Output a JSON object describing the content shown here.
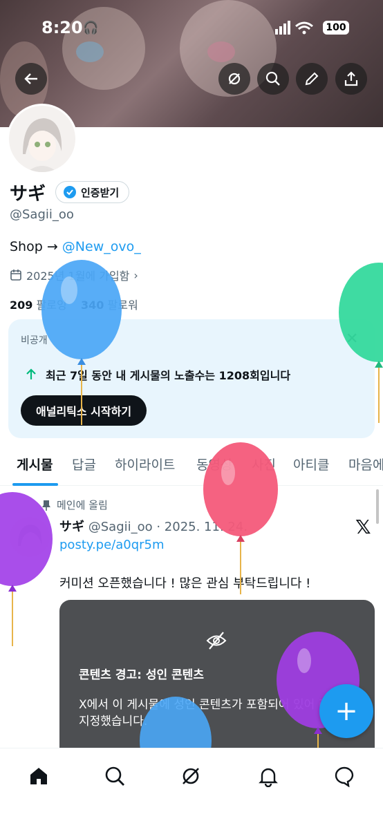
{
  "status_bar": {
    "time": "8:20",
    "battery": "100"
  },
  "profile": {
    "name": "サギ",
    "verify_label": "인증받기",
    "handle": "@Sagii_oo",
    "bio_prefix": "Shop → ",
    "bio_link": "@New_ovo_",
    "joined": "2025년 1월에 가입함",
    "following_count": "209",
    "following_label": "팔로잉",
    "followers_count": "340",
    "followers_label": "팔로워"
  },
  "analytics_card": {
    "private_label": "비공개",
    "stat_text": "최근 7일 동안 내 게시물의 노출수는 1208회입니다",
    "cta_label": "애널리틱스 시작하기"
  },
  "tabs": [
    "게시물",
    "답글",
    "하이라이트",
    "동영상",
    "사진",
    "아티클",
    "마음에"
  ],
  "post": {
    "pinned_label": "메인에 올림",
    "author": "サギ",
    "handle_date": "@Sagii_oo · 2025. 11. 24.",
    "link": "posty.pe/a0qr5m",
    "text": "커미션 오픈했습니다 ! 많은 관심 부탁드립니다 !",
    "warning_title": "콘텐츠 경고: 성인 콘텐츠",
    "warning_body": "X에서 이 게시물에 성인 콘텐츠가 포함되어 있어 라벨을 지정했습니다."
  },
  "colors": {
    "accent": "#1d9bf0",
    "text": "#0f1419",
    "muted": "#536471",
    "card_bg": "#e8f5fd"
  }
}
